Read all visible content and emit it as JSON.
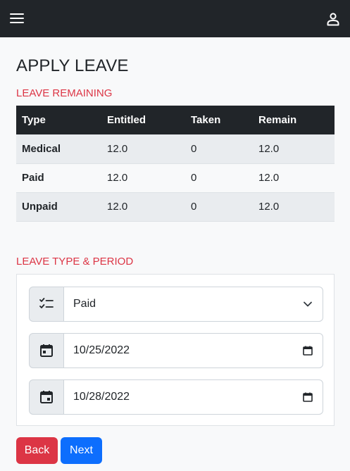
{
  "page": {
    "title": "APPLY LEAVE"
  },
  "navbar": {
    "menu_icon": "hamburger-icon",
    "user_icon": "user-icon"
  },
  "leave_remaining": {
    "heading": "LEAVE REMAINING",
    "columns": [
      "Type",
      "Entitled",
      "Taken",
      "Remain"
    ],
    "rows": [
      [
        "Medical",
        "12.0",
        "0",
        "12.0"
      ],
      [
        "Paid",
        "12.0",
        "0",
        "12.0"
      ],
      [
        "Unpaid",
        "12.0",
        "0",
        "12.0"
      ]
    ]
  },
  "leave_form": {
    "heading": "LEAVE TYPE & PERIOD",
    "leave_type": {
      "value": "Paid",
      "icon": "checklist-icon"
    },
    "start_date": {
      "value": "10/25/2022",
      "icon": "calendar-icon"
    },
    "end_date": {
      "value": "10/28/2022",
      "icon": "calendar-icon"
    }
  },
  "buttons": {
    "back": "Back",
    "next": "Next"
  },
  "colors": {
    "navbar": "#212529",
    "accent_red": "#dc3545",
    "primary_blue": "#0d6efd",
    "table_header": "#212529",
    "table_stripe": "#e9ecef",
    "addon_bg": "#e9ecef"
  }
}
